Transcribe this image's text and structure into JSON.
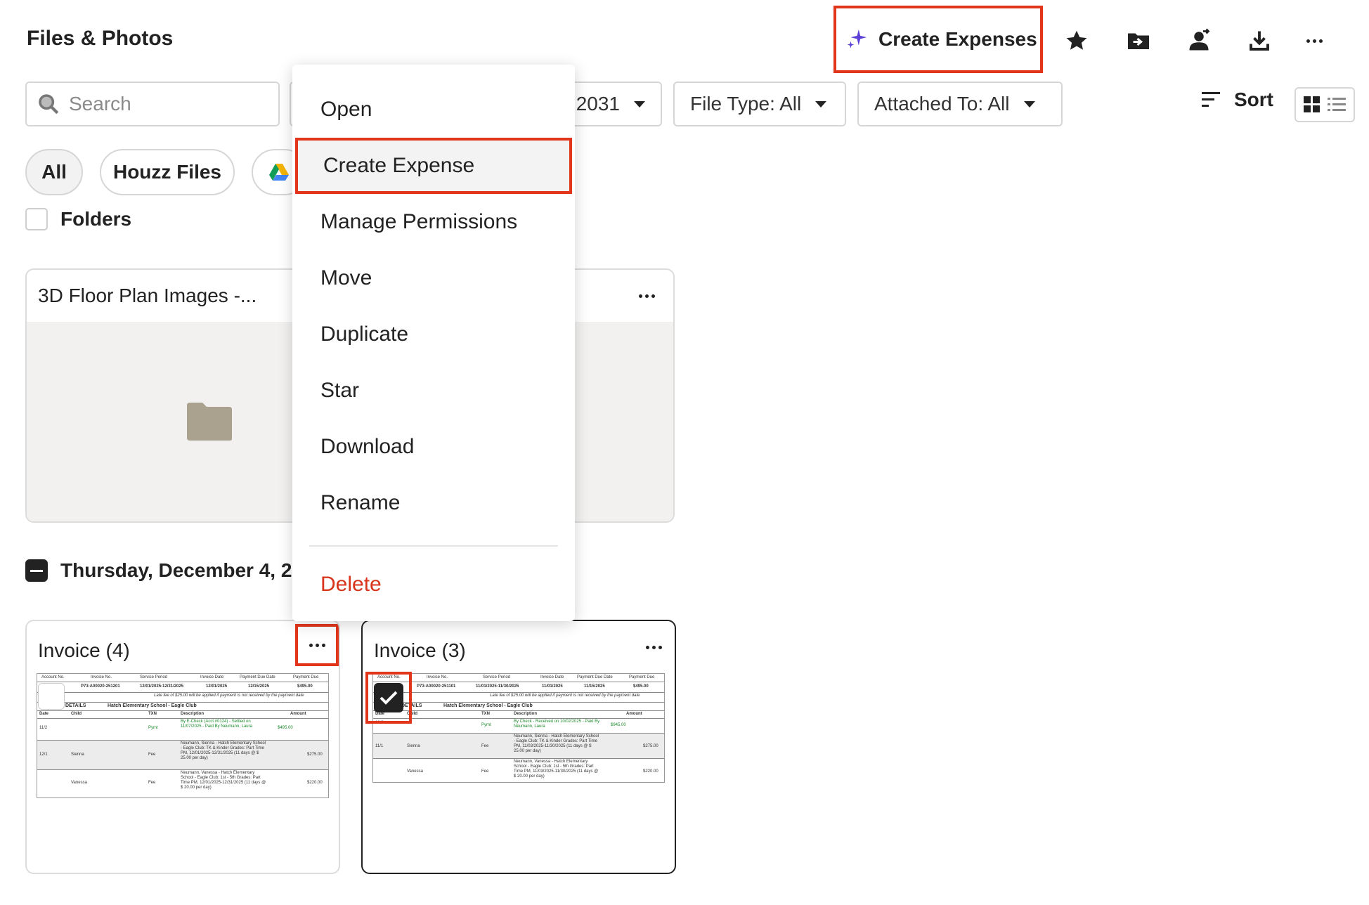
{
  "header": {
    "title": "Files & Photos",
    "create_expenses_label": "Create Expenses",
    "icons": [
      "sparkle-icon",
      "star-icon",
      "move-folder-icon",
      "share-user-icon",
      "download-icon",
      "more-icon"
    ]
  },
  "filters": {
    "search_placeholder": "Search",
    "date_filter_visible": "2031",
    "file_type": "File Type: All",
    "attached_to": "Attached To: All",
    "sort_label": "Sort"
  },
  "chips": [
    {
      "label": "All",
      "active": true
    },
    {
      "label": "Houzz Files",
      "active": false
    }
  ],
  "folders_label": "Folders",
  "folder_card": {
    "title": "3D Floor Plan Images -..."
  },
  "date_group": {
    "label": "Thursday, December 4, 20"
  },
  "context_menu": {
    "items": [
      "Open",
      "Create Expense",
      "Manage Permissions",
      "Move",
      "Duplicate",
      "Star",
      "Download",
      "Rename"
    ],
    "highlighted": "Create Expense",
    "danger_item": "Delete"
  },
  "invoices": [
    {
      "title": "Invoice (4)",
      "selected": false,
      "doc": {
        "headers": [
          "Account No.",
          "Invoice No.",
          "Service Period",
          "Invoice Date",
          "Payment Due Date",
          "Payment Due"
        ],
        "values": [
          "",
          "P73-A00020-251201",
          "12/01/2025-12/31/2025",
          "12/01/2025",
          "12/15/2025",
          "$495.00"
        ],
        "late_fee": "Late fee of $25.00 will be applied if payment is not received by the payment date",
        "details_label": "DETAILS",
        "school": "Hatch Elementary School - Eagle Club",
        "cols": [
          "Date",
          "Child",
          "TXN",
          "Description",
          "Amount"
        ],
        "rows": [
          {
            "date": "11/2",
            "child": "",
            "txn": "Pymt",
            "desc": "By E-Check (Acct #0124) - Settled on 11/07/2025 - Paid By Neumann, Laura",
            "amount": "$495.00",
            "green": true
          },
          {
            "date": "12/1",
            "child": "Sienna",
            "txn": "Fee",
            "desc": "Neumann, Sienna - Hatch Elementary School - Eagle Club: TK & Kinder Grades: Part Time PM, 12/01/2025-12/31/2025 (11 days @ $ 25.00 per day)",
            "amount": "$275.00",
            "green": false
          },
          {
            "date": "",
            "child": "Vanessa",
            "txn": "Fee",
            "desc": "Neumann, Vanessa - Hatch Elementary School - Eagle Club: 1st - 5th Grades: Part Time PM, 12/01/2025-12/31/2025 (11 days @ $ 20.00 per day)",
            "amount": "$220.00",
            "green": false
          }
        ]
      }
    },
    {
      "title": "Invoice (3)",
      "selected": true,
      "doc": {
        "headers": [
          "Account No.",
          "Invoice No.",
          "Service Period",
          "Invoice Date",
          "Payment Due Date",
          "Payment Due"
        ],
        "values": [
          "",
          "P73-A00020-251101",
          "11/01/2025-11/30/2025",
          "11/01/2025",
          "11/15/2025",
          "$495.00"
        ],
        "late_fee": "Late fee of $25.00 will be applied if payment is not received by the payment date",
        "details_label": "DETAILS",
        "school": "Hatch Elementary School - Eagle Club",
        "cols": [
          "Date",
          "Child",
          "TXN",
          "Description",
          "Amount"
        ],
        "rows": [
          {
            "date": "10/2",
            "child": "",
            "txn": "Pymt",
            "desc": "By Check - Received on 10/02/2025 - Paid By Neumann, Laura",
            "amount": "$945.00",
            "green": true
          },
          {
            "date": "11/1",
            "child": "Sienna",
            "txn": "Fee",
            "desc": "Neumann, Sienna - Hatch Elementary School - Eagle Club: TK & Kinder Grades: Part Time PM, 11/03/2025-11/30/2025 (11 days @ $ 25.00 per day)",
            "amount": "$275.00",
            "green": false
          },
          {
            "date": "",
            "child": "Vanessa",
            "txn": "Fee",
            "desc": "Neumann, Vanessa - Hatch Elementary School - Eagle Club: 1st - 5th Grades: Part Time PM, 11/03/2025-11/30/2025 (11 days @ $ 20.00 per day)",
            "amount": "$220.00",
            "green": false
          }
        ]
      }
    }
  ],
  "colors": {
    "highlight_red": "#e2361c",
    "danger": "#d8341c",
    "accent_purple": "#5b3fd6"
  }
}
